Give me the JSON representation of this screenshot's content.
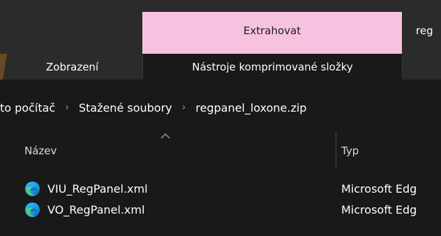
{
  "ribbon": {
    "context_tab_label": "Extrahovat",
    "right_tab_label": "reg",
    "tabs": [
      {
        "label": "Zobrazení"
      },
      {
        "label": "Nástroje komprimované složky"
      }
    ]
  },
  "address": {
    "crumbs": [
      {
        "label": "to počítač"
      },
      {
        "label": "Stažené soubory"
      },
      {
        "label": "regpanel_loxone.zip"
      }
    ],
    "separator_glyph": "›"
  },
  "columns": {
    "name": "Název",
    "type": "Typ"
  },
  "files": [
    {
      "name": "VIU_RegPanel.xml",
      "type": "Microsoft Edg",
      "icon": "edge-icon"
    },
    {
      "name": "VO_RegPanel.xml",
      "type": "Microsoft Edg",
      "icon": "edge-icon"
    }
  ],
  "colors": {
    "context_tab": "#f7c2df",
    "background": "#191919",
    "ribbon": "#2b2b2b"
  }
}
